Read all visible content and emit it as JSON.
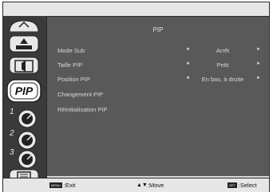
{
  "menu": {
    "title": "PIP",
    "items": [
      {
        "label": "Mode Sub",
        "value": "Arrêt",
        "left_arrow": "◄",
        "right_arrow": "►"
      },
      {
        "label": "Taille PIP",
        "value": "Petit",
        "left_arrow": "◄",
        "right_arrow": "►"
      },
      {
        "label": "Position PIP",
        "value": "En bas, à droite",
        "left_arrow": "◄",
        "right_arrow": "►"
      },
      {
        "label": "Changement PIP"
      },
      {
        "label": "Réinitialisation PIP"
      }
    ]
  },
  "sidebar": {
    "items": [
      {
        "name": "picture-icon"
      },
      {
        "name": "screen-icon"
      },
      {
        "name": "audio-icon"
      },
      {
        "name": "pip-icon",
        "label": "PIP",
        "selected": true
      },
      {
        "name": "config1-icon",
        "number": "1"
      },
      {
        "name": "config2-icon",
        "number": "2"
      },
      {
        "name": "config3-icon",
        "number": "3"
      },
      {
        "name": "advanced-option-icon"
      }
    ]
  },
  "footer": {
    "exit_key": "MENU",
    "exit_label": ":Exit",
    "move_key": "▲▼",
    "move_label": ":Move",
    "select_key": "SET",
    "select_label": ":Select"
  },
  "colors": {
    "sidebar_bg": "#3a3a3a",
    "content_bg": "#595959",
    "bar_bg": "#e6e6e6",
    "selected_icon_bg": "#ffffff"
  }
}
